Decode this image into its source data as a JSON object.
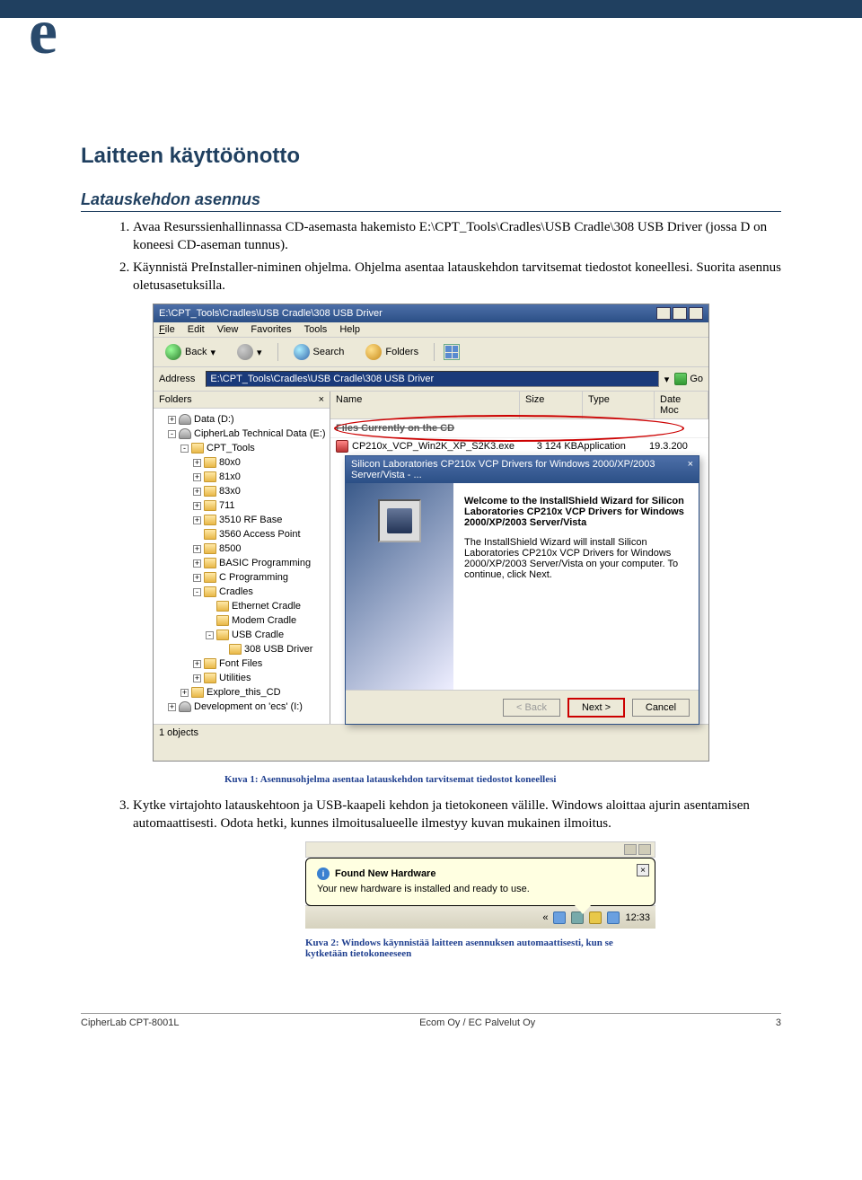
{
  "header": {
    "logo_letter": "e",
    "h1": "Laitteen käyttöönotto",
    "h2": "Latauskehdon asennus"
  },
  "steps": {
    "s1": "Avaa Resurssienhallinnassa CD-asemasta hakemisto E:\\CPT_Tools\\Cradles\\USB Cradle\\308 USB Driver (jossa D on koneesi CD-aseman tunnus).",
    "s2": "Käynnistä PreInstaller-niminen ohjelma. Ohjelma asentaa latauskehdon tarvitsemat tiedostot koneellesi. Suorita asennus oletusasetuksilla.",
    "s3": "Kytke virtajohto latauskehtoon ja USB-kaapeli kehdon ja tietokoneen välille. Windows aloittaa ajurin asentamisen automaattisesti. Odota hetki, kunnes ilmoitusalueelle ilmestyy kuvan mukainen ilmoitus."
  },
  "fig1": {
    "caption": "Kuva 1: Asennusohjelma asentaa latauskehdon tarvitsemat tiedostot koneellesi",
    "titlebar": "E:\\CPT_Tools\\Cradles\\USB Cradle\\308 USB Driver",
    "menu": {
      "file": "File",
      "edit": "Edit",
      "view": "View",
      "fav": "Favorites",
      "tools": "Tools",
      "help": "Help"
    },
    "toolbar": {
      "back": "Back",
      "search": "Search",
      "folders": "Folders"
    },
    "address_label": "Address",
    "address_value": "E:\\CPT_Tools\\Cradles\\USB Cradle\\308 USB Driver",
    "go": "Go",
    "folders_hdr": "Folders",
    "tree": [
      {
        "ind": 1,
        "sq": "+",
        "ico": "d",
        "t": "Data (D:)"
      },
      {
        "ind": 1,
        "sq": "-",
        "ico": "d",
        "t": "CipherLab Technical Data (E:)"
      },
      {
        "ind": 2,
        "sq": "-",
        "ico": "f",
        "t": "CPT_Tools"
      },
      {
        "ind": 3,
        "sq": "+",
        "ico": "f",
        "t": "80x0"
      },
      {
        "ind": 3,
        "sq": "+",
        "ico": "f",
        "t": "81x0"
      },
      {
        "ind": 3,
        "sq": "+",
        "ico": "f",
        "t": "83x0"
      },
      {
        "ind": 3,
        "sq": "+",
        "ico": "f",
        "t": "711"
      },
      {
        "ind": 3,
        "sq": "+",
        "ico": "f",
        "t": "3510 RF Base"
      },
      {
        "ind": 3,
        "sq": "",
        "ico": "f",
        "t": "3560 Access Point"
      },
      {
        "ind": 3,
        "sq": "+",
        "ico": "f",
        "t": "8500"
      },
      {
        "ind": 3,
        "sq": "+",
        "ico": "f",
        "t": "BASIC Programming"
      },
      {
        "ind": 3,
        "sq": "+",
        "ico": "f",
        "t": "C Programming"
      },
      {
        "ind": 3,
        "sq": "-",
        "ico": "f",
        "t": "Cradles"
      },
      {
        "ind": 4,
        "sq": "",
        "ico": "f",
        "t": "Ethernet Cradle"
      },
      {
        "ind": 4,
        "sq": "",
        "ico": "f",
        "t": "Modem Cradle"
      },
      {
        "ind": 4,
        "sq": "-",
        "ico": "f",
        "t": "USB Cradle"
      },
      {
        "ind": 5,
        "sq": "",
        "ico": "f",
        "t": "308 USB Driver"
      },
      {
        "ind": 3,
        "sq": "+",
        "ico": "f",
        "t": "Font Files"
      },
      {
        "ind": 3,
        "sq": "+",
        "ico": "f",
        "t": "Utilities"
      },
      {
        "ind": 2,
        "sq": "+",
        "ico": "f",
        "t": "Explore_this_CD"
      },
      {
        "ind": 1,
        "sq": "+",
        "ico": "d",
        "t": "Development on 'ecs' (I:)"
      }
    ],
    "list": {
      "h_name": "Name",
      "h_size": "Size",
      "h_type": "Type",
      "h_date": "Date Moc",
      "group": "Files Currently on the CD",
      "file_name": "CP210x_VCP_Win2K_XP_S2K3.exe",
      "file_size": "3 124 KB",
      "file_type": "Application",
      "file_date": "19.3.200"
    },
    "status": "1 objects",
    "wizard": {
      "titlebar": "Silicon Laboratories CP210x VCP Drivers for Windows 2000/XP/2003 Server/Vista - ...",
      "welcome": "Welcome to the InstallShield Wizard for Silicon Laboratories CP210x VCP Drivers for Windows 2000/XP/2003 Server/Vista",
      "body": "The InstallShield Wizard will install Silicon Laboratories CP210x VCP Drivers for Windows 2000/XP/2003 Server/Vista on your computer. To continue, click Next.",
      "back": "< Back",
      "next": "Next >",
      "cancel": "Cancel"
    }
  },
  "fig2": {
    "caption": "Kuva 2: Windows käynnistää laitteen asennuksen automaattisesti, kun se kytketään tietokoneeseen",
    "balloon_title": "Found New Hardware",
    "balloon_body": "Your new hardware is installed and ready to use.",
    "clock": "12:33"
  },
  "footer": {
    "left": "CipherLab CPT-8001L",
    "center": "Ecom Oy / EC Palvelut Oy",
    "right": "3"
  }
}
